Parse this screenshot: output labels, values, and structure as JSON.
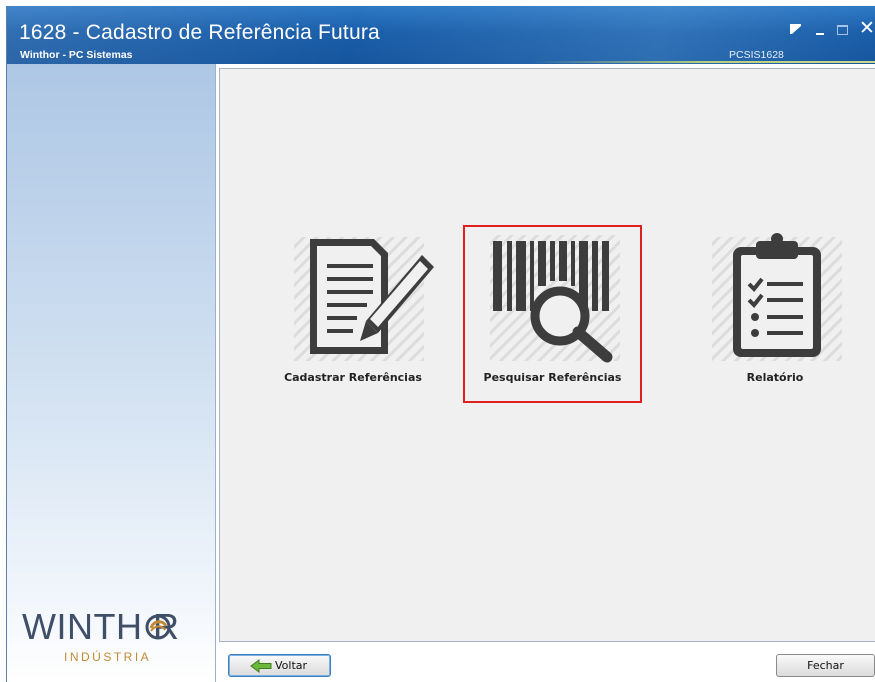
{
  "window": {
    "title": "1628 - Cadastro de Referência Futura",
    "subtitle": "Winthor - PC Sistemas",
    "routine_code": "PCSIS1628"
  },
  "controls": {
    "restore_icon": "restore-icon",
    "minimize_icon": "minimize-icon",
    "maximize_icon": "maximize-icon",
    "close_icon": "close-icon",
    "close_glyph": "✕"
  },
  "sidebar": {
    "logo_word": "WINTH R",
    "logo_sub": "INDÚSTRIA"
  },
  "tiles": [
    {
      "label": "Cadastrar Referências",
      "icon": "document-pencil-icon",
      "selected": false
    },
    {
      "label": "Pesquisar Referências",
      "icon": "barcode-search-icon",
      "selected": true
    },
    {
      "label": "Relatório",
      "icon": "clipboard-checklist-icon",
      "selected": false
    }
  ],
  "footer": {
    "back_label": "Voltar",
    "back_icon": "green-left-arrow-icon",
    "close_label": "Fechar"
  },
  "colors": {
    "titlebar": "#1a5ea9",
    "selection_border": "#e02020",
    "icon_dark": "#3d3d3d",
    "logo_accent": "#c38a36"
  }
}
